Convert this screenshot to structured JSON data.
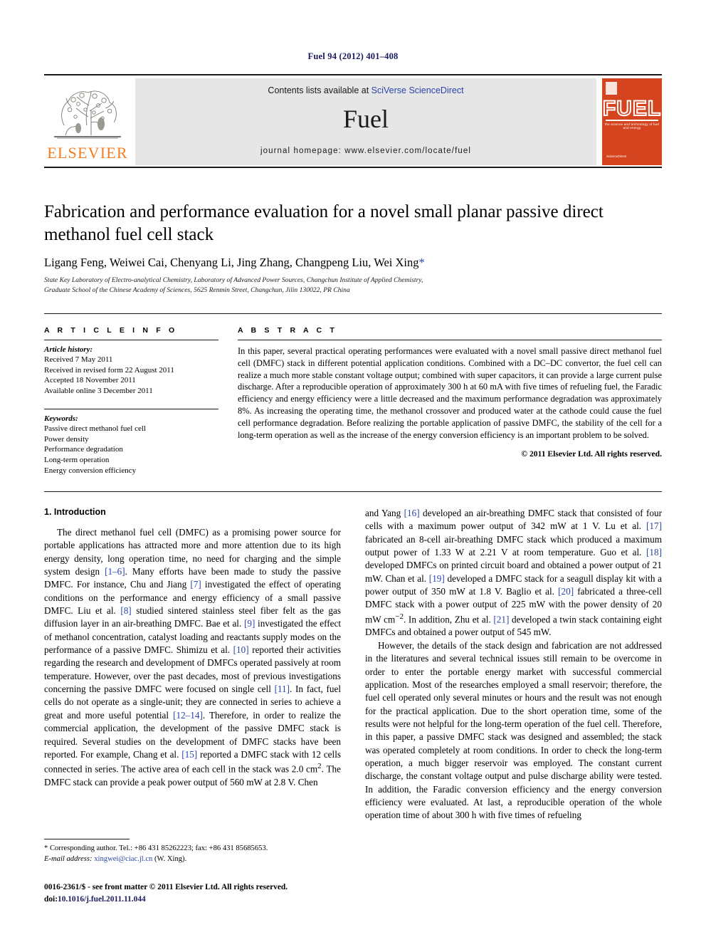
{
  "running_head": "Fuel 94 (2012) 401–408",
  "masthead": {
    "contents_prefix": "Contents lists available at ",
    "sciencedirect_link": "SciVerse ScienceDirect",
    "journal_name": "Fuel",
    "homepage": "journal homepage: www.elsevier.com/locate/fuel",
    "publisher_wordmark": "ELSEVIER",
    "cover": {
      "title": "FUEL",
      "subtitle": "the science and technology of fuel and energy",
      "footer": "ScienceDirect"
    }
  },
  "article": {
    "title": "Fabrication and performance evaluation for a novel small planar passive direct methanol fuel cell stack",
    "authors": "Ligang Feng, Weiwei Cai, Chenyang Li, Jing Zhang, Changpeng Liu, Wei Xing",
    "corresponding_marker": "*",
    "affiliation_line1": "State Key Laboratory of Electro-analytical Chemistry, Laboratory of Advanced Power Sources, Changchun Institute of Applied Chemistry,",
    "affiliation_line2": "Graduate School of the Chinese Academy of Sciences, 5625 Renmin Street, Changchun, Jilin 130022, PR China"
  },
  "info": {
    "heading": "A R T I C L E    I N F O",
    "history_label": "Article history:",
    "history": [
      "Received 7 May 2011",
      "Received in revised form 22 August 2011",
      "Accepted 18 November 2011",
      "Available online 3 December 2011"
    ],
    "keywords_label": "Keywords:",
    "keywords": [
      "Passive direct methanol fuel cell",
      "Power density",
      "Performance degradation",
      "Long-term operation",
      "Energy conversion efficiency"
    ]
  },
  "abstract": {
    "heading": "A B S T R A C T",
    "text": "In this paper, several practical operating performances were evaluated with a novel small passive direct methanol fuel cell (DMFC) stack in different potential application conditions. Combined with a DC–DC convertor, the fuel cell can realize a much more stable constant voltage output; combined with super capacitors, it can provide a large current pulse discharge. After a reproducible operation of approximately 300 h at 60 mA with five times of refueling fuel, the Faradic efficiency and energy efficiency were a little decreased and the maximum performance degradation was approximately 8%. As increasing the operating time, the methanol crossover and produced water at the cathode could cause the fuel cell performance degradation. Before realizing the portable application of passive DMFC, the stability of the cell for a long-term operation as well as the increase of the energy conversion efficiency is an important problem to be solved.",
    "copyright": "© 2011 Elsevier Ltd. All rights reserved."
  },
  "body": {
    "section_heading": "1. Introduction",
    "left_para1_a": "The direct methanol fuel cell (DMFC) as a promising power source for portable applications has attracted more and more attention due to its high energy density, long operation time, no need for charging and the simple system design ",
    "left_ref_1_6": "[1–6]",
    "left_para1_b": ". Many efforts have been made to study the passive DMFC. For instance, Chu and Jiang ",
    "left_ref_7": "[7]",
    "left_para1_c": " investigated the effect of operating conditions on the performance and energy efficiency of a small passive DMFC. Liu et al. ",
    "left_ref_8": "[8]",
    "left_para1_d": " studied sintered stainless steel fiber felt as the gas diffusion layer in an air-breathing DMFC. Bae et al. ",
    "left_ref_9": "[9]",
    "left_para1_e": " investigated the effect of methanol concentration, catalyst loading and reactants supply modes on the performance of a passive DMFC. Shimizu et al. ",
    "left_ref_10": "[10]",
    "left_para1_f": " reported their activities regarding the research and development of DMFCs operated passively at room temperature. However, over the past decades, most of previous investigations concerning the passive DMFC were focused on single cell ",
    "left_ref_11": "[11]",
    "left_para1_g": ". In fact, fuel cells do not operate as a single-unit; they are connected in series to achieve a great and more useful potential ",
    "left_ref_12_14": "[12–14]",
    "left_para1_h": ". Therefore, in order to realize the commercial application, the development of the passive DMFC stack is required. Several studies on the development of DMFC stacks have been reported. For example, Chang et al. ",
    "left_ref_15": "[15]",
    "left_para1_i": " reported a DMFC stack with 12 cells connected in series. The active area of each cell in the stack was 2.0 cm",
    "left_sup_2": "2",
    "left_para1_j": ". The DMFC stack can provide a peak power output of 560 mW at 2.8 V. Chen",
    "right_para1_a": "and Yang ",
    "right_ref_16": "[16]",
    "right_para1_b": " developed an air-breathing DMFC stack that consisted of four cells with a maximum power output of 342 mW at 1 V. Lu et al. ",
    "right_ref_17": "[17]",
    "right_para1_c": " fabricated an 8-cell air-breathing DMFC stack which produced a maximum output power of 1.33 W at 2.21 V at room temperature. Guo et al. ",
    "right_ref_18": "[18]",
    "right_para1_d": " developed DMFCs on printed circuit board and obtained a power output of 21 mW. Chan et al. ",
    "right_ref_19": "[19]",
    "right_para1_e": " developed a DMFC stack for a seagull display kit with a power output of 350 mW at 1.8 V. Baglio et al. ",
    "right_ref_20": "[20]",
    "right_para1_f": " fabricated a three-cell DMFC stack with a power output of 225 mW with the power density of 20 mW cm",
    "right_sup_neg2": "−2",
    "right_para1_g": ". In addition, Zhu et al. ",
    "right_ref_21": "[21]",
    "right_para1_h": " developed a twin stack containing eight DMFCs and obtained a power output of 545 mW.",
    "right_para2": "However, the details of the stack design and fabrication are not addressed in the literatures and several technical issues still remain to be overcome in order to enter the portable energy market with successful commercial application. Most of the researches employed a small reservoir; therefore, the fuel cell operated only several minutes or hours and the result was not enough for the practical application. Due to the short operation time, some of the results were not helpful for the long-term operation of the fuel cell. Therefore, in this paper, a passive DMFC stack was designed and assembled; the stack was operated completely at room conditions. In order to check the long-term operation, a much bigger reservoir was employed. The constant current discharge, the constant voltage output and pulse discharge ability were tested. In addition, the Faradic conversion efficiency and the energy conversion efficiency were evaluated. At last, a reproducible operation of the whole operation time of about 300 h with five times of refueling"
  },
  "footnotes": {
    "corresponding": "* Corresponding author. Tel.: +86 431 85262223; fax: +86 431 85685653.",
    "email_label": "E-mail address:",
    "email": "xingwei@ciac.jl.cn",
    "email_suffix": "(W. Xing).",
    "issn_line": "0016-2361/$ - see front matter © 2011 Elsevier Ltd. All rights reserved.",
    "doi_label": "doi:",
    "doi_value": "10.1016/j.fuel.2011.11.044"
  },
  "colors": {
    "link_blue": "#2a45a8",
    "elsevier_orange": "#f47c20",
    "cover_red": "#d4451f",
    "band_gray": "#e6e6e6"
  }
}
